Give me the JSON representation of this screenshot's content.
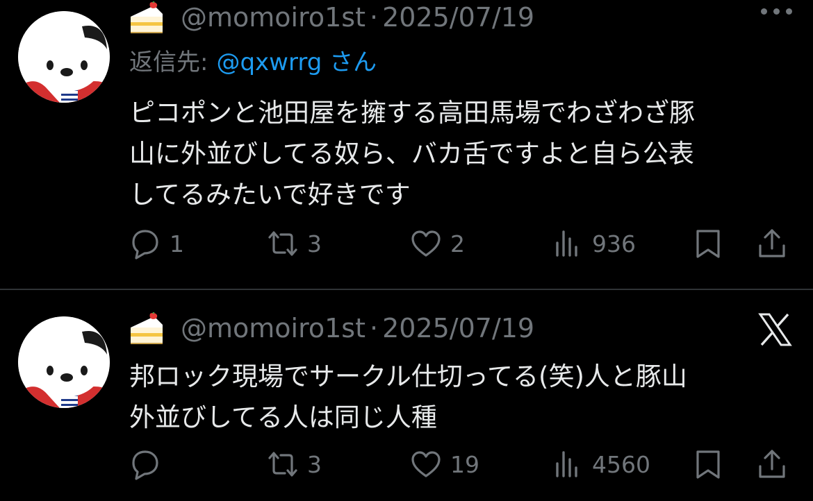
{
  "theme": {
    "background": "#000000",
    "text": "#e7e9ea",
    "muted": "#71767b",
    "link": "#1d9bf0"
  },
  "tweets": [
    {
      "handle": "@momoiro1st",
      "separator": "·",
      "date": "2025/07/19",
      "reply_prefix": "返信先:",
      "reply_mention": "@qxwrrg さん",
      "text_lines": [
        "ピコポンと池田屋を擁する高田馬場でわざわざ豚",
        "山に外並びしてる奴ら、バカ舌ですよと自ら公表",
        "してるみたいで好きです"
      ],
      "stats": {
        "replies": "1",
        "retweets": "3",
        "likes": "2",
        "views": "936"
      },
      "icons": [
        "cake-emoji",
        "more-icon",
        "reply-icon",
        "retweet-icon",
        "like-icon",
        "views-icon",
        "bookmark-icon",
        "share-icon"
      ]
    },
    {
      "handle": "@momoiro1st",
      "separator": "·",
      "date": "2025/07/19",
      "text_lines": [
        "邦ロック現場でサークル仕切ってる(笑)人と豚山",
        "外並びしてる人は同じ人種"
      ],
      "stats": {
        "replies": "",
        "retweets": "3",
        "likes": "19",
        "views": "4560"
      },
      "icons": [
        "cake-emoji",
        "x-logo-icon",
        "reply-icon",
        "retweet-icon",
        "like-icon",
        "views-icon",
        "bookmark-icon",
        "share-icon"
      ]
    }
  ]
}
